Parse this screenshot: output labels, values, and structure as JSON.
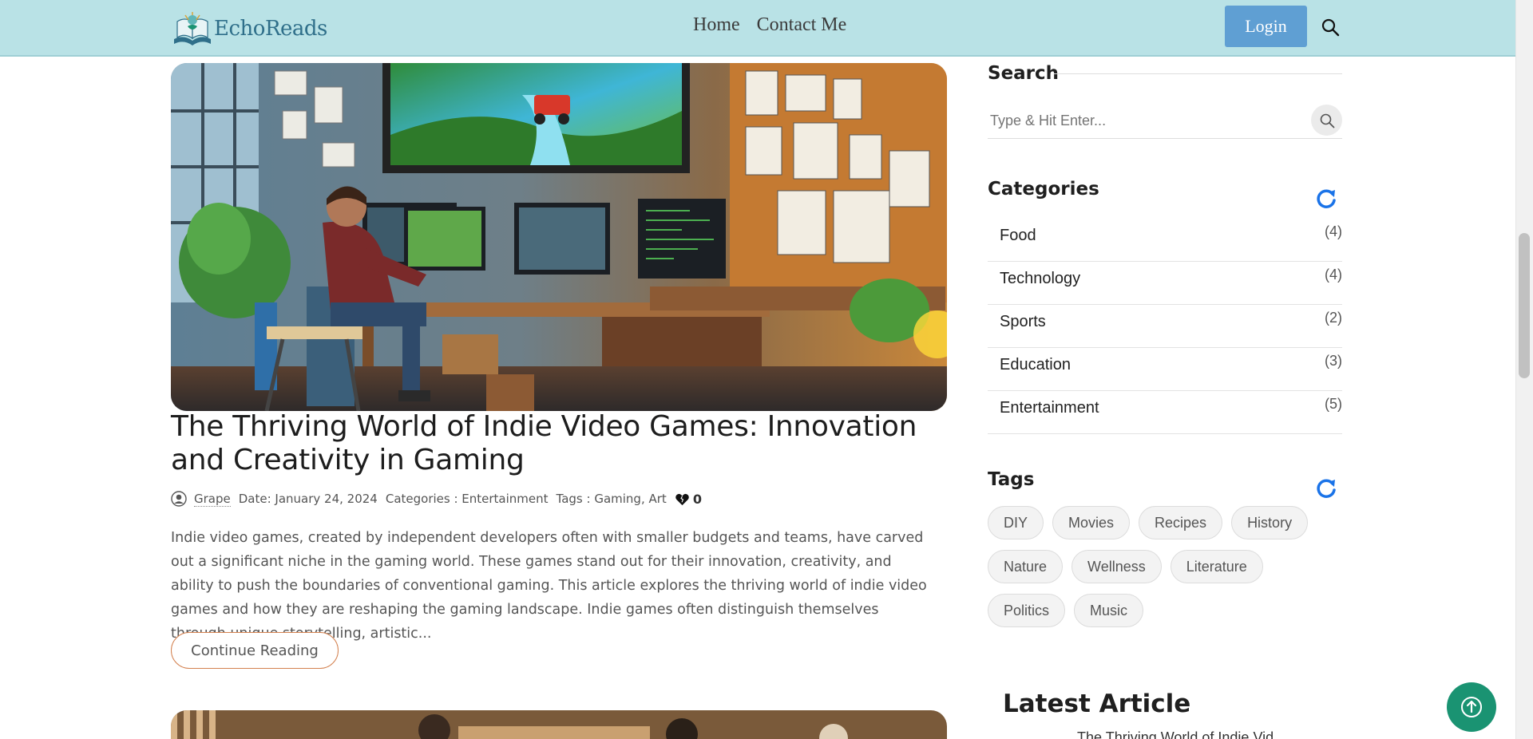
{
  "navbar": {
    "brand_name": "EchoReads",
    "links": [
      "Home",
      "Contact Me"
    ],
    "login_label": "Login",
    "bg_color": "#b9e2e6",
    "login_color": "#5f9fd3"
  },
  "article": {
    "title": "The Thriving World of Indie Video Games: Innovation and Creativity in Gaming",
    "author": "Grape",
    "date": "Date: January 24, 2024",
    "categories": "Categories : Entertainment",
    "tags": "Tags : Gaming, Art",
    "likes": "0",
    "excerpt": "Indie video games, created by independent developers often with smaller budgets and teams, have carved out a significant niche in the gaming world. These games stand out for their innovation, creativity, and ability to push the boundaries of conventional gaming. This article explores the thriving world of indie video games and how they are reshaping the gaming landscape. Indie games often distinguish themselves through unique storytelling, artistic...",
    "continue_label": "Continue Reading",
    "button_border_color": "#d3814f"
  },
  "sidebar": {
    "search_heading": "Search",
    "search_placeholder": "Type & Hit Enter...",
    "categories_heading": "Categories",
    "categories": [
      {
        "name": "Food",
        "count": "(4)"
      },
      {
        "name": "Technology",
        "count": "(4)"
      },
      {
        "name": "Sports",
        "count": "(2)"
      },
      {
        "name": "Education",
        "count": "(3)"
      },
      {
        "name": "Entertainment",
        "count": "(5)"
      }
    ],
    "tags_heading": "Tags",
    "tags": [
      "DIY",
      "Movies",
      "Recipes",
      "History",
      "Nature",
      "Wellness",
      "Literature",
      "Politics",
      "Music"
    ],
    "latest_heading": "Latest Article",
    "latest_first": "The Thriving World of Indie Vid..."
  },
  "colors": {
    "accent_blue": "#1a73e8",
    "to_top_green": "#1a9372"
  },
  "icons": [
    "book-logo-icon",
    "search-icon",
    "user-icon",
    "heart-icon",
    "refresh-icon",
    "arrow-up-icon"
  ]
}
